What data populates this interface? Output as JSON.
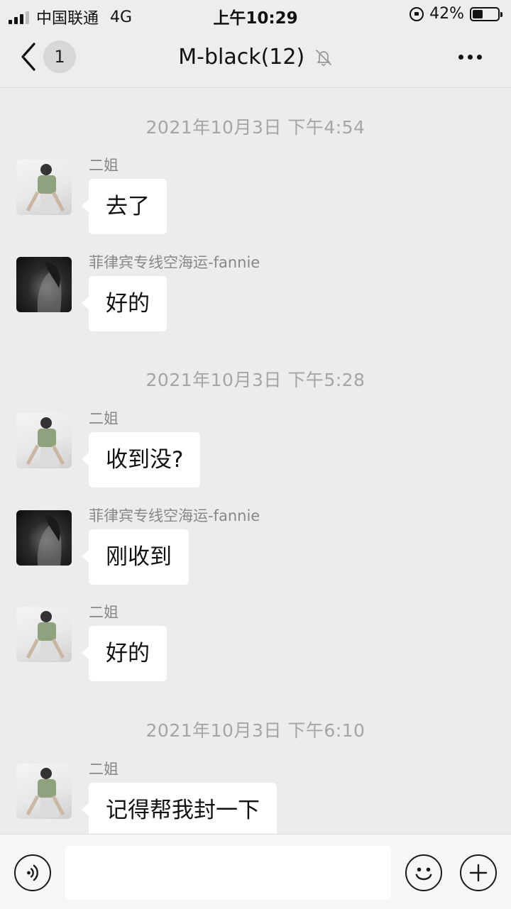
{
  "status_bar": {
    "carrier": "中国联通",
    "network": "4G",
    "time": "上午10:29",
    "battery_percent": "42%",
    "battery_level": 0.42
  },
  "nav": {
    "unread_count": "1",
    "title": "M-black(12)",
    "icons": [
      "back-chevron-icon",
      "mute-bell-icon",
      "more-dots-icon"
    ]
  },
  "chat": {
    "timestamps": [
      "2021年10月3日 下午4:54",
      "2021年10月3日 下午5:28",
      "2021年10月3日 下午6:10"
    ],
    "messages": [
      {
        "sender": "二姐",
        "text": "去了"
      },
      {
        "sender": "菲律宾专线空海运-fannie",
        "text": "好的"
      },
      {
        "sender": "二姐",
        "text": "收到没?"
      },
      {
        "sender": "菲律宾专线空海运-fannie",
        "text": "刚收到"
      },
      {
        "sender": "二姐",
        "text": "好的"
      },
      {
        "sender": "二姐",
        "text": "记得帮我封一下"
      }
    ]
  },
  "input_bar": {
    "message_value": "",
    "icons": [
      "voice-icon",
      "emoji-icon",
      "plus-icon"
    ]
  }
}
